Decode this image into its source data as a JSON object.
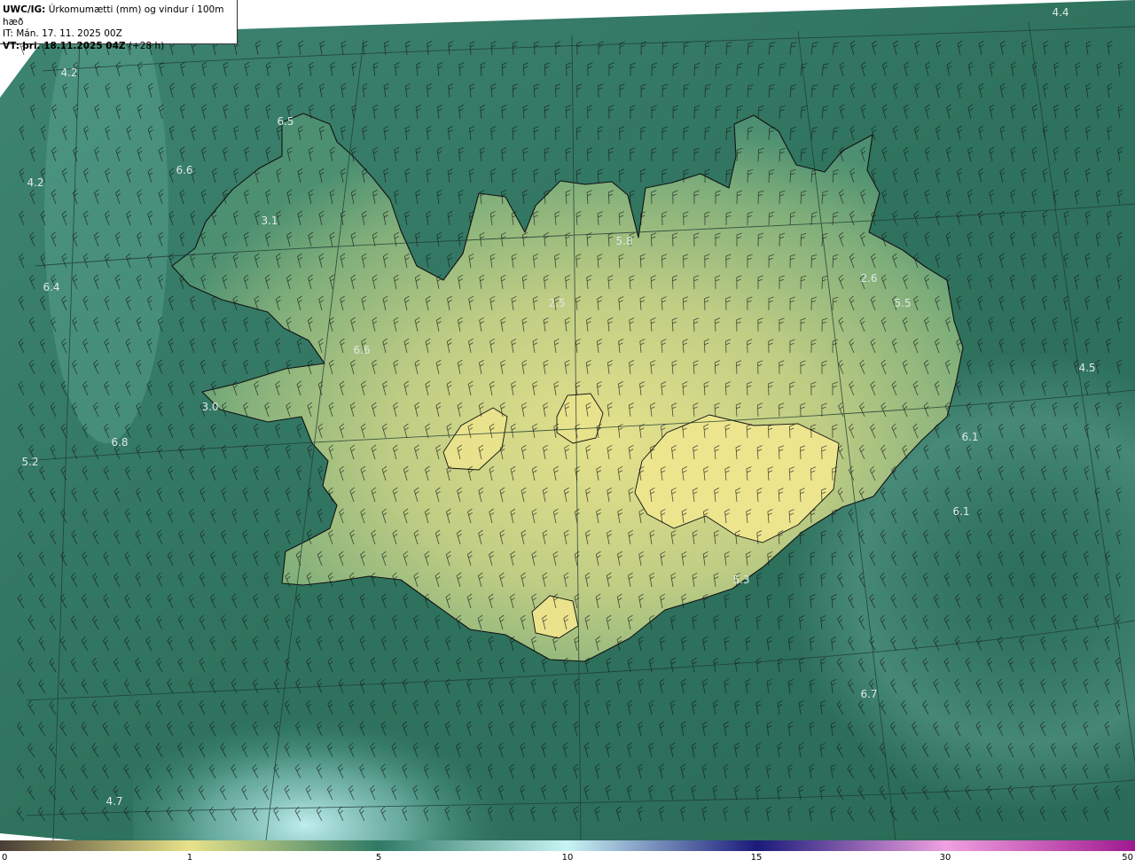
{
  "header": {
    "model": "UWC/IG:",
    "title": "Úrkomumætti (mm) og vindur í 100m hæð",
    "init_label": "IT:",
    "init_time": "Mán. 17. 11. 2025 00Z",
    "valid_label": "VT:",
    "valid_time": "þri. 18.11.2025 04Z",
    "forecast_hour": "(+28 h)"
  },
  "colorbar": {
    "ticks": [
      "0",
      "1",
      "5",
      "10",
      "15",
      "30",
      "50"
    ],
    "tick_values": [
      0,
      1,
      5,
      10,
      15,
      30,
      50
    ],
    "colors": {
      "0": "#4a3f35",
      "1": "#e8e28a",
      "5": "#2f7a66",
      "10": "#c8f4f4",
      "15": "#1a1a7a",
      "30": "#f0a0e0",
      "50": "#a01890"
    }
  },
  "map_labels": [
    {
      "text": "4.4"
    },
    {
      "text": "4.2"
    },
    {
      "text": "6.5"
    },
    {
      "text": "6.6"
    },
    {
      "text": "4.2"
    },
    {
      "text": "3.1"
    },
    {
      "text": "6.4"
    },
    {
      "text": "5.8"
    },
    {
      "text": "2.6"
    },
    {
      "text": "5.5"
    },
    {
      "text": "2.5"
    },
    {
      "text": "6.6"
    },
    {
      "text": "4.5"
    },
    {
      "text": "3.0"
    },
    {
      "text": "6.1"
    },
    {
      "text": "6.8"
    },
    {
      "text": "5.2"
    },
    {
      "text": "6.1"
    },
    {
      "text": "5.3"
    },
    {
      "text": "6.7"
    },
    {
      "text": "4.7"
    }
  ],
  "colors": {
    "ocean_dark": "#2c6e58",
    "ocean_light": "#5aa08e",
    "land_moist": "#7fae7a",
    "land_dry": "#e4e08c",
    "coastline": "#111111",
    "barb": "#1a1a1a",
    "label": "#dfe9e4"
  }
}
